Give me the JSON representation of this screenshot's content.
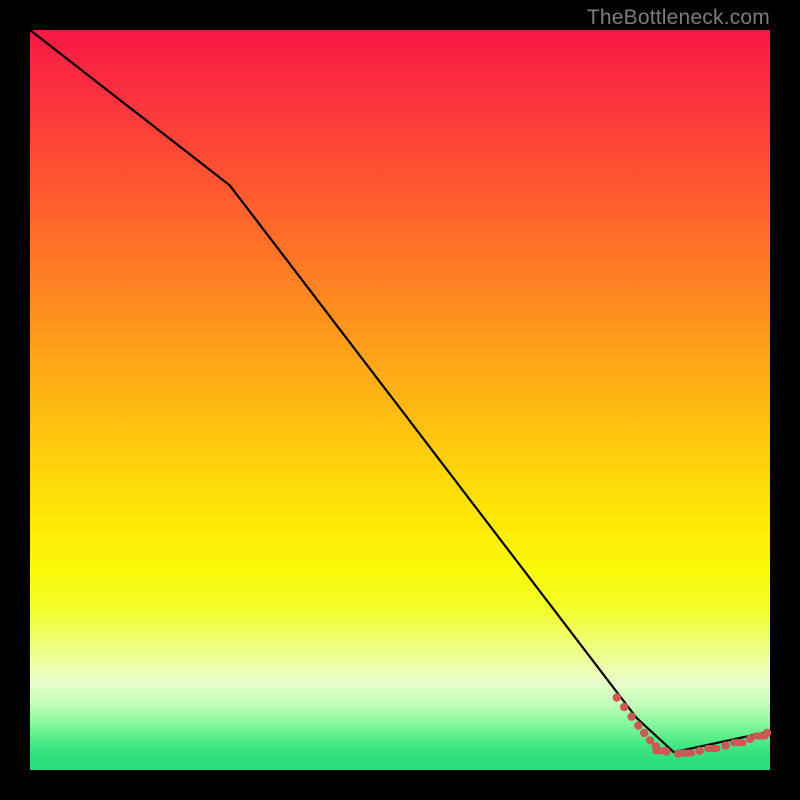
{
  "watermark": "TheBottleneck.com",
  "colors": {
    "background": "#000000",
    "curve": "#000000",
    "marker": "#cb5a55",
    "gradient_top": "#f91844",
    "gradient_bottom": "#28dc79"
  },
  "chart_data": {
    "type": "line",
    "title": "",
    "xlabel": "",
    "ylabel": "",
    "xlim": [
      0,
      100
    ],
    "ylim": [
      0,
      100
    ],
    "grid": false,
    "legend": false,
    "curve_points_xy": [
      [
        0,
        100
      ],
      [
        27,
        79
      ],
      [
        82,
        7
      ],
      [
        87,
        2.4
      ],
      [
        100,
        5.2
      ]
    ],
    "marker_dots_xy": [
      [
        79.3,
        9.8
      ],
      [
        80.3,
        8.5
      ],
      [
        81.3,
        7.2
      ],
      [
        82.2,
        6.0
      ],
      [
        83.0,
        5.0
      ],
      [
        83.8,
        4.0
      ],
      [
        84.6,
        3.2
      ],
      [
        86.0,
        2.5
      ],
      [
        87.6,
        2.2
      ],
      [
        90.5,
        2.6
      ],
      [
        94.0,
        3.3
      ],
      [
        97.3,
        4.2
      ],
      [
        99.6,
        5.0
      ]
    ],
    "marker_dashes_xy": [
      [
        85.2,
        2.6
      ],
      [
        88.8,
        2.3
      ],
      [
        92.2,
        2.9
      ],
      [
        95.7,
        3.7
      ],
      [
        98.7,
        4.6
      ]
    ]
  }
}
